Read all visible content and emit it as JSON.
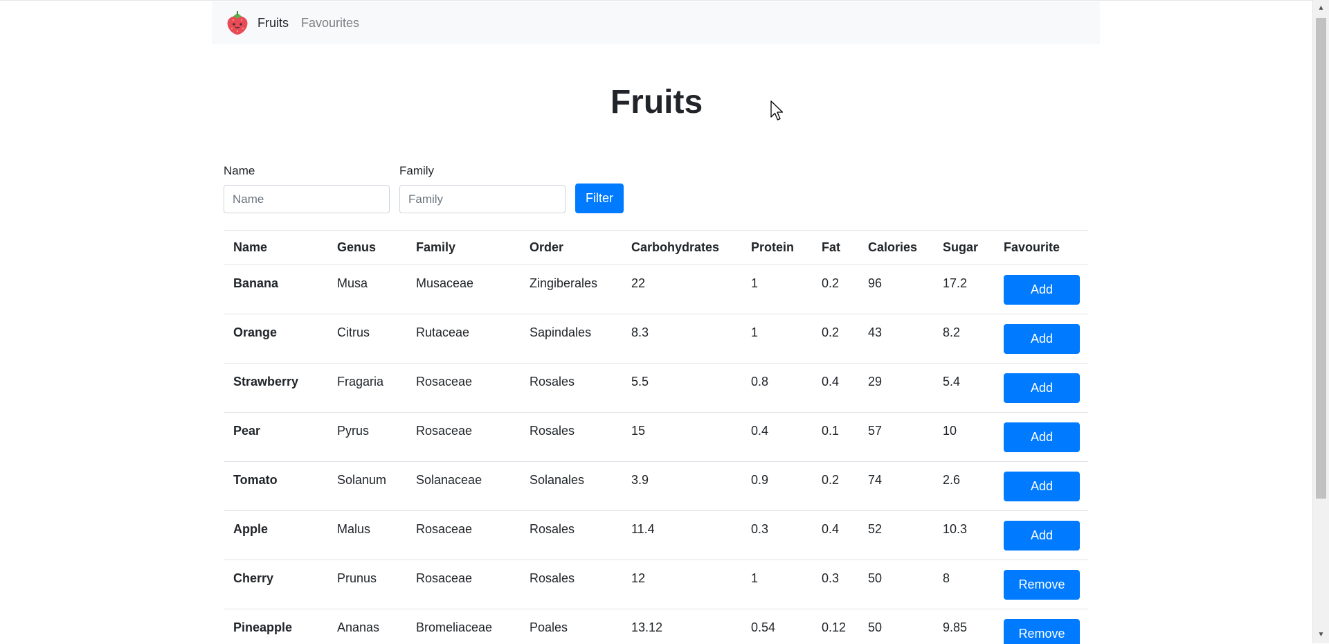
{
  "navbar": {
    "brand_label": "Fruits",
    "favourites_label": "Favourites",
    "logo_icon": "strawberry-icon"
  },
  "page": {
    "title": "Fruits"
  },
  "filter": {
    "name_label": "Name",
    "name_placeholder": "Name",
    "name_value": "",
    "family_label": "Family",
    "family_placeholder": "Family",
    "family_value": "",
    "button_label": "Filter"
  },
  "table": {
    "headers": [
      "Name",
      "Genus",
      "Family",
      "Order",
      "Carbohydrates",
      "Protein",
      "Fat",
      "Calories",
      "Sugar",
      "Favourite"
    ],
    "rows": [
      {
        "name": "Banana",
        "genus": "Musa",
        "family": "Musaceae",
        "order": "Zingiberales",
        "carbohydrates": "22",
        "protein": "1",
        "fat": "0.2",
        "calories": "96",
        "sugar": "17.2",
        "action": "Add"
      },
      {
        "name": "Orange",
        "genus": "Citrus",
        "family": "Rutaceae",
        "order": "Sapindales",
        "carbohydrates": "8.3",
        "protein": "1",
        "fat": "0.2",
        "calories": "43",
        "sugar": "8.2",
        "action": "Add"
      },
      {
        "name": "Strawberry",
        "genus": "Fragaria",
        "family": "Rosaceae",
        "order": "Rosales",
        "carbohydrates": "5.5",
        "protein": "0.8",
        "fat": "0.4",
        "calories": "29",
        "sugar": "5.4",
        "action": "Add"
      },
      {
        "name": "Pear",
        "genus": "Pyrus",
        "family": "Rosaceae",
        "order": "Rosales",
        "carbohydrates": "15",
        "protein": "0.4",
        "fat": "0.1",
        "calories": "57",
        "sugar": "10",
        "action": "Add"
      },
      {
        "name": "Tomato",
        "genus": "Solanum",
        "family": "Solanaceae",
        "order": "Solanales",
        "carbohydrates": "3.9",
        "protein": "0.9",
        "fat": "0.2",
        "calories": "74",
        "sugar": "2.6",
        "action": "Add"
      },
      {
        "name": "Apple",
        "genus": "Malus",
        "family": "Rosaceae",
        "order": "Rosales",
        "carbohydrates": "11.4",
        "protein": "0.3",
        "fat": "0.4",
        "calories": "52",
        "sugar": "10.3",
        "action": "Add"
      },
      {
        "name": "Cherry",
        "genus": "Prunus",
        "family": "Rosaceae",
        "order": "Rosales",
        "carbohydrates": "12",
        "protein": "1",
        "fat": "0.3",
        "calories": "50",
        "sugar": "8",
        "action": "Remove"
      },
      {
        "name": "Pineapple",
        "genus": "Ananas",
        "family": "Bromeliaceae",
        "order": "Poales",
        "carbohydrates": "13.12",
        "protein": "0.54",
        "fat": "0.12",
        "calories": "50",
        "sugar": "9.85",
        "action": "Remove"
      }
    ]
  },
  "colors": {
    "primary": "#007bff",
    "navbar_bg": "#f8f9fa",
    "text": "#212529",
    "muted": "#7d7f82",
    "strawberry_red": "#e84b55",
    "leaf_green": "#5bb04a"
  }
}
